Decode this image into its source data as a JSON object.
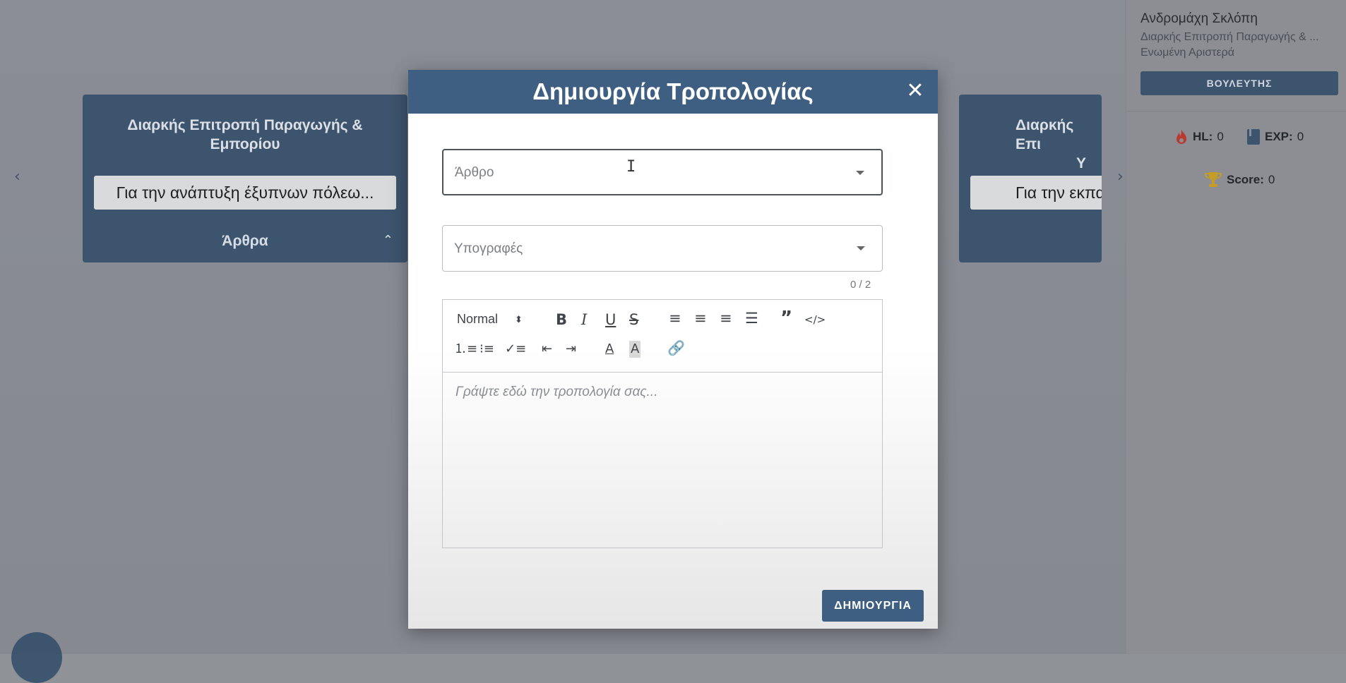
{
  "background": {
    "cards": [
      {
        "committee": "Διαρκής Επιτροπή Παραγωγής & Εμπορίου",
        "bill": "Για την ανάπτυξη έξυπνων πόλεω...",
        "section": "Άρθρα"
      },
      {
        "committee_visible": "Διαρκής Επι",
        "committee_line2": "Υ",
        "bill": "Για την εκπα"
      }
    ],
    "prev_arrow": "‹",
    "next_arrow": "›"
  },
  "sidebar": {
    "user_name": "Ανδρομάχη Σκλόπη",
    "committee": "Διαρκής Επιτροπή Παραγωγής & ...",
    "party": "Ενωμένη Αριστερά",
    "role": "ΒΟΥΛΕΥΤΗΣ",
    "stats": {
      "hl_label": "HL:",
      "hl_value": "0",
      "exp_label": "EXP:",
      "exp_value": "0",
      "score_label": "Score:",
      "score_value": "0"
    },
    "colors": {
      "fire": "#c0392b",
      "trophy": "#c9a227"
    }
  },
  "modal": {
    "title": "Δημιουργία Τροπολογίας",
    "close_symbol": "✕",
    "article_placeholder": "Άρθρο",
    "signatures_placeholder": "Υπογραφές",
    "signatures_counter": "0 / 2",
    "editor": {
      "format_select": "Normal",
      "placeholder": "Γράψτε εδώ την τροπολογία σας..."
    },
    "create_label": "ΔΗΜΙΟΥΡΓΙΑ"
  },
  "colors": {
    "primary": "#3e5f82",
    "card": "#3e5670"
  }
}
